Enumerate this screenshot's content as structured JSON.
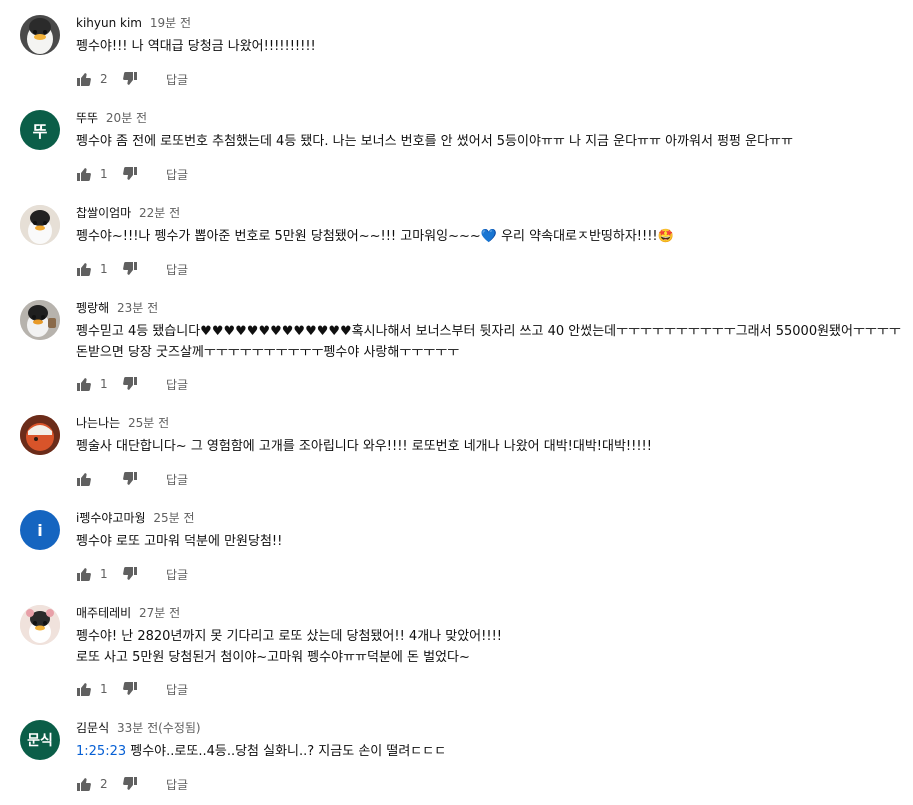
{
  "colors": {
    "author": "#0f0f0f",
    "meta": "#606060",
    "link": "#065fd4",
    "avatar_green": "#0b5e48",
    "avatar_blue": "#1565c0"
  },
  "reply_label": "답글",
  "comments": [
    {
      "author": "kihyun kim",
      "time": "19분 전",
      "lines": [
        "펭수야!!! 나 역대급 당청금 나왔어!!!!!!!!!!"
      ],
      "likes": "2",
      "avatar": "penguin-photo"
    },
    {
      "author": "뚜뚜",
      "time": "20분 전",
      "lines": [
        "펭수야 좀 전에 로또번호 추첨했는데 4등 됐다. 나는 보너스 번호를 안 썼어서 5등이야ㅠㅠ 나 지금 운다ㅠㅠ 아까워서 펑펑 운다ㅠㅠ"
      ],
      "likes": "1",
      "avatar_letter": "뚜"
    },
    {
      "author": "찹쌀이엄마",
      "time": "22분 전",
      "line_pre": "펭수야~!!!나 펭수가 뽑아준 번호로 5만원 당첨됐어~~!!! 고마워잉~~~",
      "line_post": " 우리 약속대로ㅈ반띵하자!!!!",
      "heart": "💙",
      "star_face": "🤩",
      "likes": "1",
      "avatar": "penguin-photo"
    },
    {
      "author": "펭랑해",
      "time": "23분 전",
      "lines": [
        "펭수믿고 4등 됐습니다♥♥♥♥♥♥♥♥♥♥♥♥♥혹시나해서 보너스부터 뒷자리 쓰고 40 안썼는데ㅜㅜㅜㅜㅜㅜㅜㅜㅜㅜ그래서 55000원됐어ㅜㅜㅜㅜ",
        "돈받으면 당장 굿즈살께ㅜㅜㅜㅜㅜㅜㅜㅜㅜㅜ펭수야 사랑해ㅜㅜㅜㅜㅜ"
      ],
      "likes": "1",
      "avatar": "penguin-photo"
    },
    {
      "author": "나는나는",
      "time": "25분 전",
      "lines": [
        "펭술사 대단합니다~ 그 영험함에 고개를 조아립니다 와우!!!!  로또번호 네개나 나왔어 대박!대박!대박!!!!!"
      ],
      "likes": "",
      "avatar": "red-photo"
    },
    {
      "author": "i펭수야고마웡",
      "time": "25분 전",
      "lines": [
        "펭수야 로또 고마워 덕분에 만원당첨!!"
      ],
      "likes": "1",
      "avatar_letter": "i"
    },
    {
      "author": "매주테레비",
      "time": "27분 전",
      "lines": [
        "펭수야! 난 2820년까지 못 기다리고 로또 샀는데 당첨됐어!! 4개나 맞았어!!!!",
        "로또 사고 5만원 당첨된거 첨이야~고마워 펭수야ㅠㅠ덕분에 돈 벌었다~"
      ],
      "likes": "1",
      "avatar": "penguin-photo"
    },
    {
      "author": "김문식",
      "time": "33분 전(수정됨)",
      "timestamp": "1:25:23",
      "text_after_ts": " 펭수야..로또..4등..당첨 실화니..? 지금도 손이 떨려ㄷㄷㄷ",
      "likes": "2",
      "avatar_letter": "문식"
    }
  ]
}
